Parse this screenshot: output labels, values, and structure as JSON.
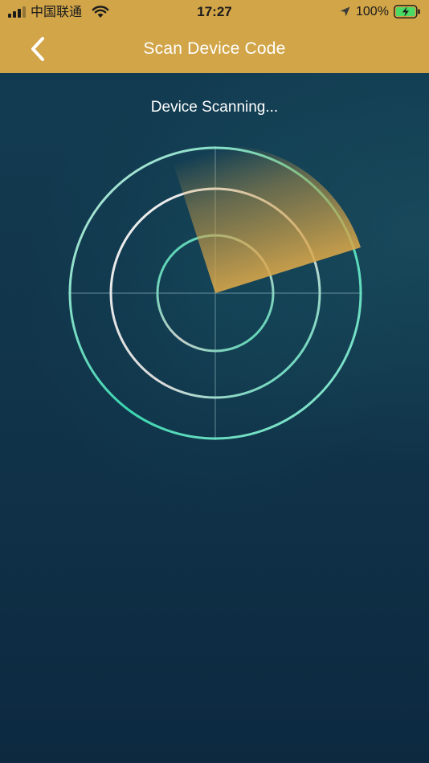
{
  "status_bar": {
    "carrier": "中国联通",
    "time": "17:27",
    "battery": "100%"
  },
  "nav": {
    "title": "Scan Device Code",
    "back_icon": "chevron-left-icon"
  },
  "scan": {
    "status_text": "Device Scanning..."
  },
  "colors": {
    "header": "#d1a548",
    "ring_teal": "#3ad6b0",
    "sweep": "#d8a545",
    "background": "#11344a"
  }
}
